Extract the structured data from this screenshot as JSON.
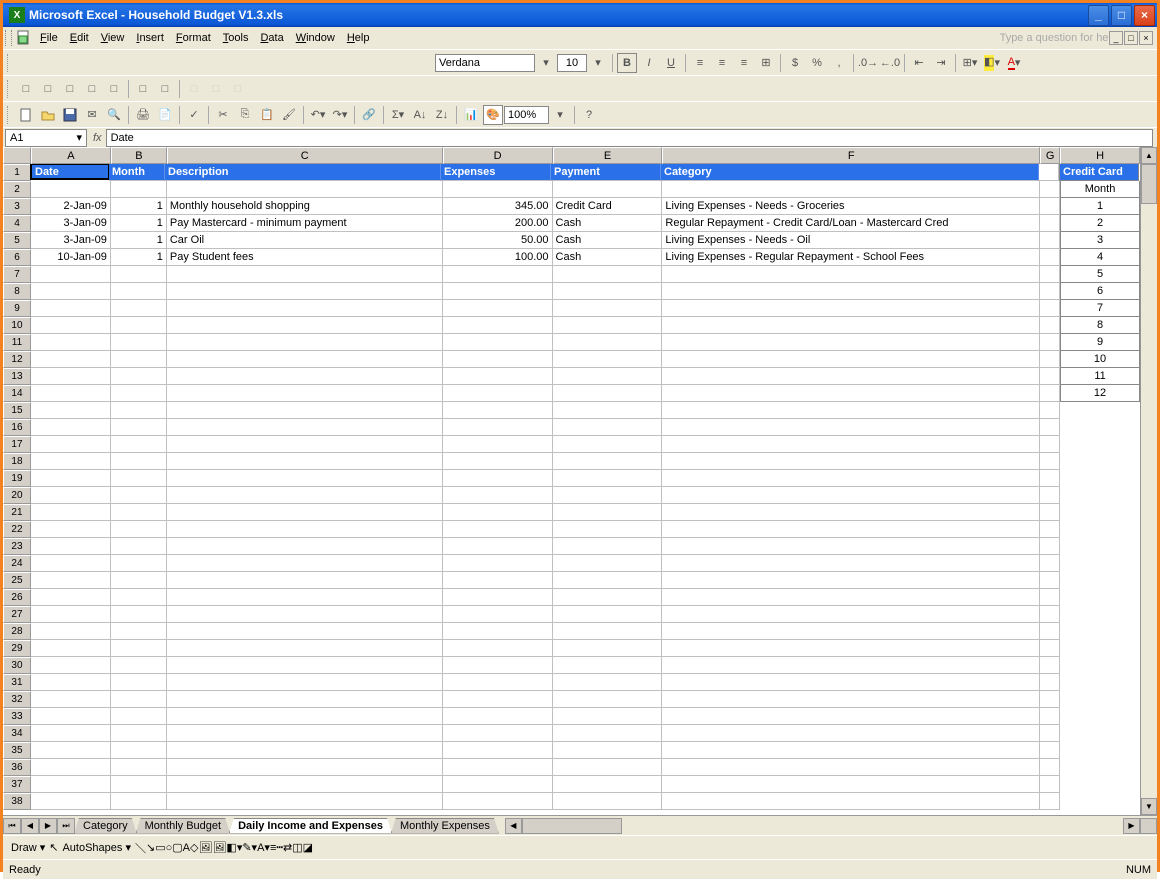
{
  "window": {
    "app": "Microsoft Excel",
    "doc": "Household Budget V1.3.xls"
  },
  "menu": [
    "File",
    "Edit",
    "View",
    "Insert",
    "Format",
    "Tools",
    "Data",
    "Window",
    "Help"
  ],
  "help_prompt": "Type a question for help",
  "formatting": {
    "font": "Verdana",
    "size": "10",
    "zoom": "100%"
  },
  "namebox": "A1",
  "formula": "Date",
  "columns": [
    "A",
    "B",
    "C",
    "D",
    "E",
    "F",
    "G",
    "H"
  ],
  "headers": {
    "A": "Date",
    "B": "Month",
    "C": "Description",
    "D": "Expenses",
    "E": "Payment",
    "F": "Category",
    "H": "Credit Card"
  },
  "rows": [
    {
      "A": "",
      "B": "",
      "C": "",
      "D": "",
      "E": "",
      "F": "",
      "H": "Month"
    },
    {
      "A": "2-Jan-09",
      "B": "1",
      "C": "Monthly household shopping",
      "D": "345.00",
      "E": "Credit Card",
      "F": "Living Expenses - Needs - Groceries",
      "H": "1"
    },
    {
      "A": "3-Jan-09",
      "B": "1",
      "C": "Pay Mastercard - minimum payment",
      "D": "200.00",
      "E": "Cash",
      "F": "Regular Repayment - Credit Card/Loan - Mastercard Cred",
      "H": "2"
    },
    {
      "A": "3-Jan-09",
      "B": "1",
      "C": "Car Oil",
      "D": "50.00",
      "E": "Cash",
      "F": "Living Expenses - Needs - Oil",
      "H": "3"
    },
    {
      "A": "10-Jan-09",
      "B": "1",
      "C": "Pay Student fees",
      "D": "100.00",
      "E": "Cash",
      "F": "Living Expenses - Regular Repayment - School Fees",
      "H": "4"
    },
    {
      "H": "5"
    },
    {
      "H": "6"
    },
    {
      "H": "7"
    },
    {
      "H": "8"
    },
    {
      "H": "9"
    },
    {
      "H": "10"
    },
    {
      "H": "11"
    },
    {
      "H": "12"
    }
  ],
  "tabs": [
    "Category",
    "Monthly Budget",
    "Daily Income and Expenses",
    "Monthly Expenses"
  ],
  "active_tab": 2,
  "draw": {
    "label": "Draw",
    "autoshapes": "AutoShapes"
  },
  "status": {
    "left": "Ready",
    "right": "NUM"
  }
}
